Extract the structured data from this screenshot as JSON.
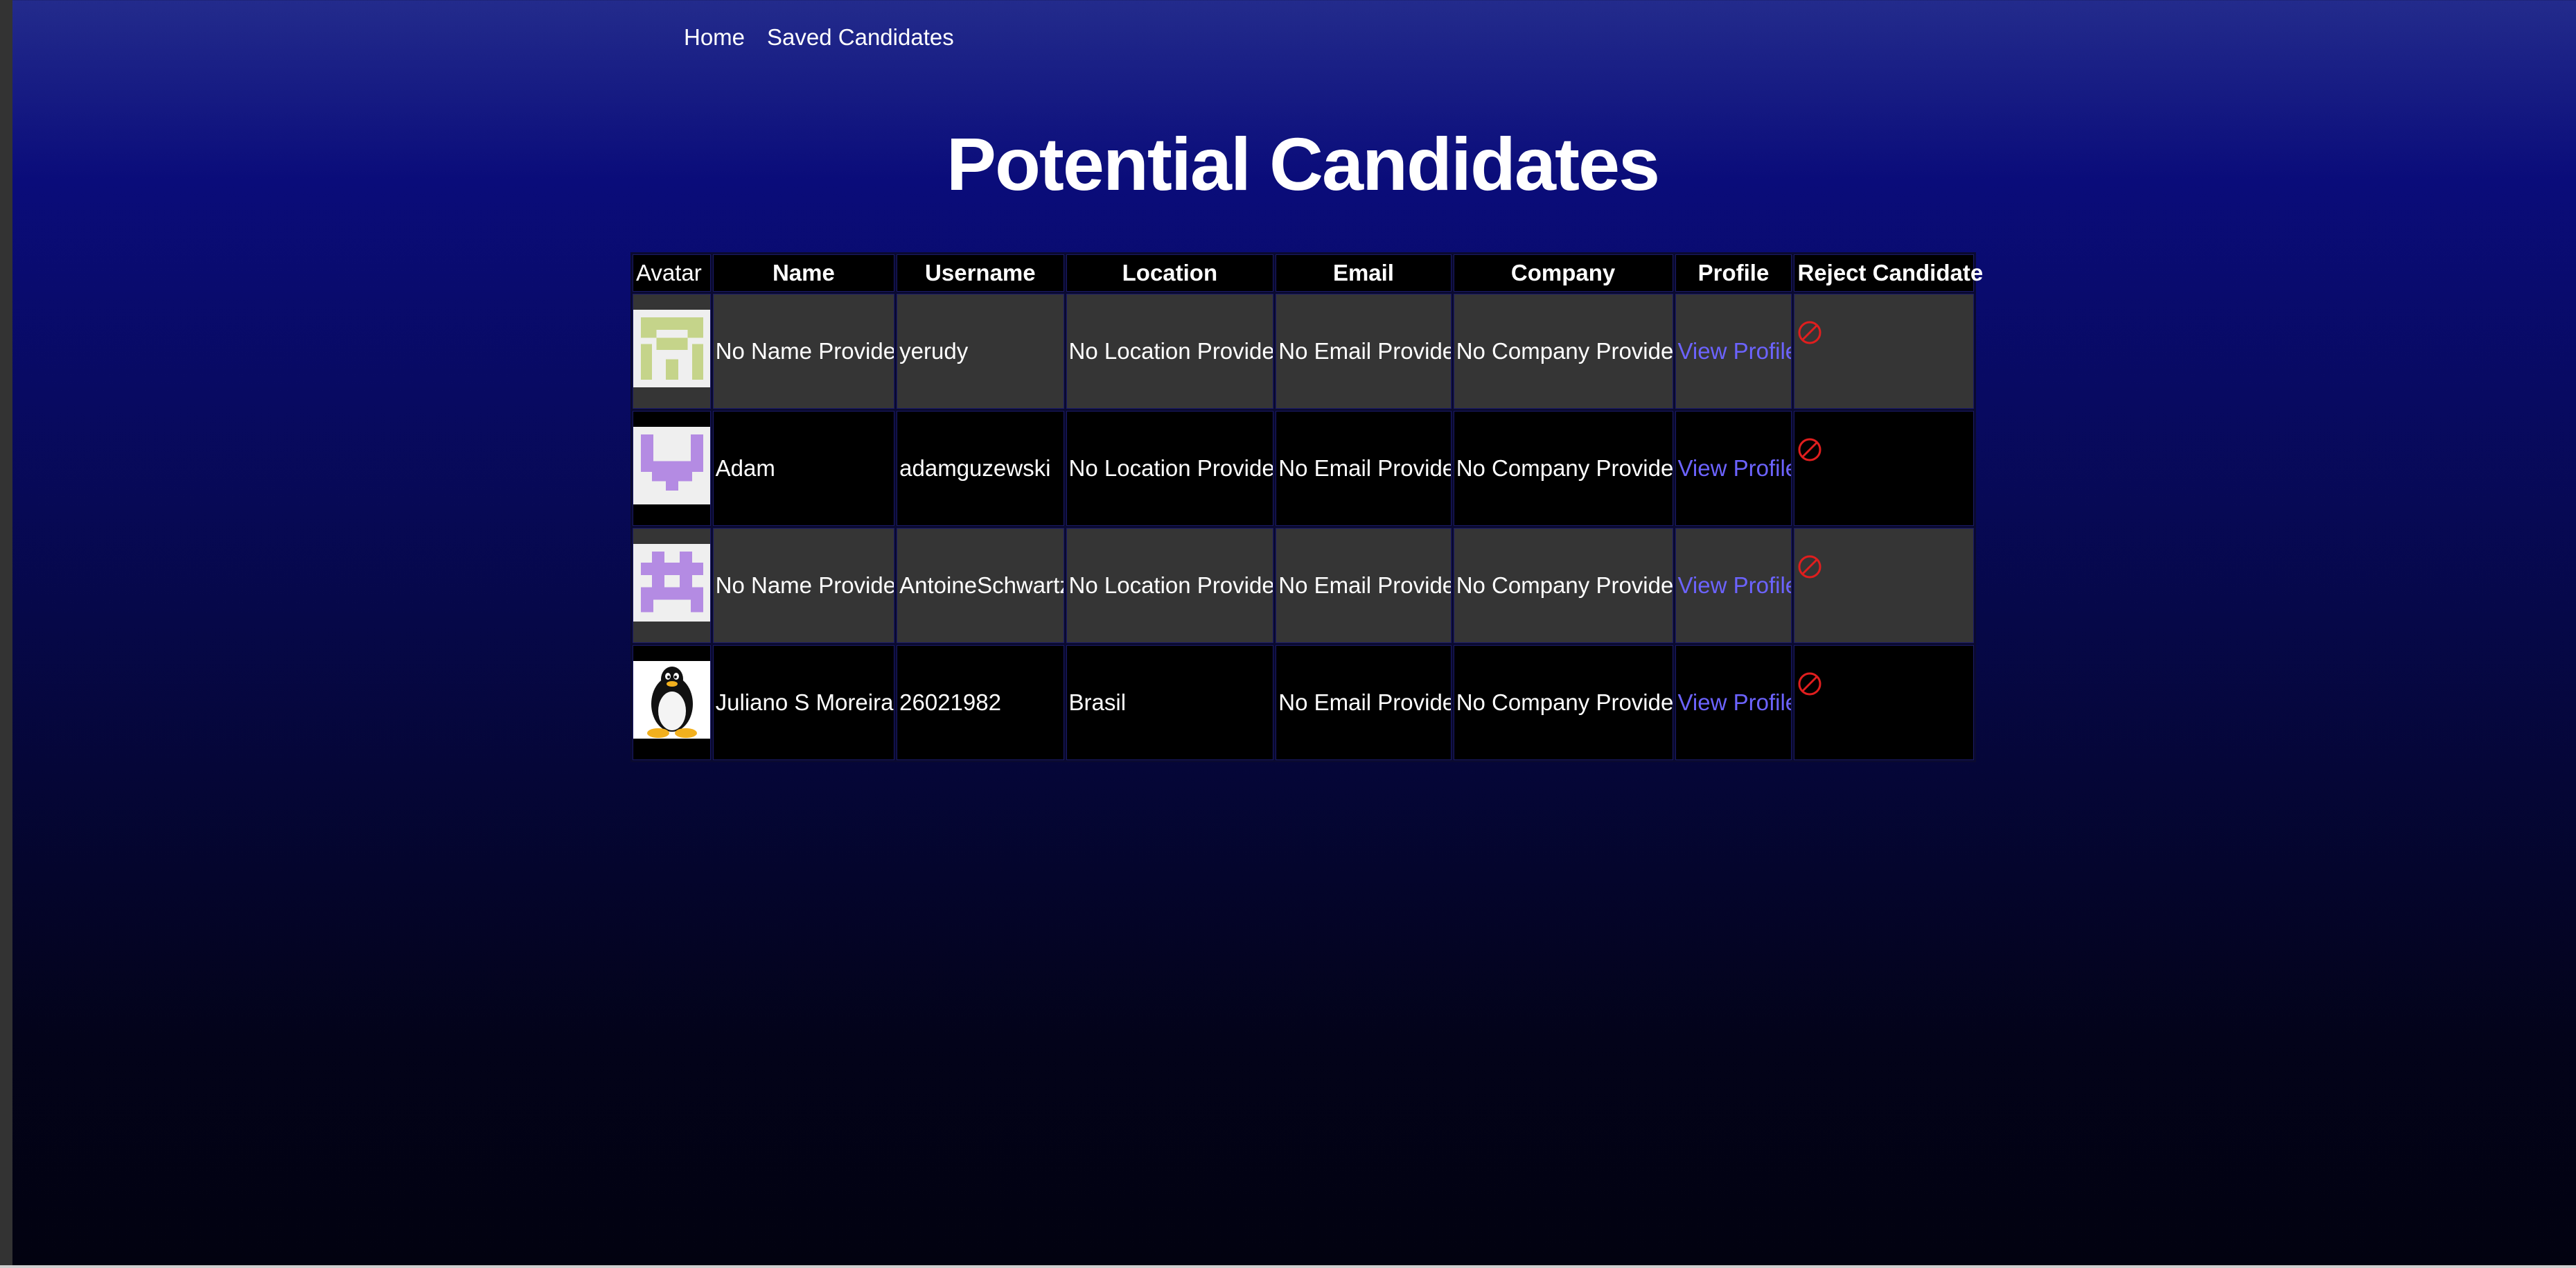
{
  "nav": {
    "home_label": "Home",
    "saved_label": "Saved Candidates"
  },
  "page": {
    "title": "Potential Candidates"
  },
  "table": {
    "headers": {
      "avatar": "Avatar",
      "name": "Name",
      "username": "Username",
      "location": "Location",
      "email": "Email",
      "company": "Company",
      "profile": "Profile",
      "reject": "Reject Candidate"
    },
    "rows": [
      {
        "avatar_icon": "identicon-green",
        "name": "No Name Provided",
        "username": "yerudy",
        "location": "No Location Provided",
        "email": "No Email Provided",
        "company": "No Company Provided",
        "profile_link": "View Profile",
        "reject_icon": "prohibited-icon"
      },
      {
        "avatar_icon": "identicon-purple",
        "name": "Adam",
        "username": "adamguzewski",
        "location": "No Location Provided",
        "email": "No Email Provided",
        "company": "No Company Provided",
        "profile_link": "View Profile",
        "reject_icon": "prohibited-icon"
      },
      {
        "avatar_icon": "identicon-purple",
        "name": "No Name Provided",
        "username": "AntoineSchwartz",
        "location": "No Location Provided",
        "email": "No Email Provided",
        "company": "No Company Provided",
        "profile_link": "View Profile",
        "reject_icon": "prohibited-icon"
      },
      {
        "avatar_icon": "penguin-avatar",
        "name": "Juliano S Moreira",
        "username": "26021982",
        "location": "Brasil",
        "email": "No Email Provided",
        "company": "No Company Provided",
        "profile_link": "View Profile",
        "reject_icon": "prohibited-icon"
      }
    ]
  },
  "colors": {
    "link": "#6c63ff",
    "reject": "#e01e1e",
    "row_odd": "#353535",
    "row_even": "#000000",
    "identicon_green": "#c5d48a",
    "identicon_purple": "#b48be3"
  }
}
